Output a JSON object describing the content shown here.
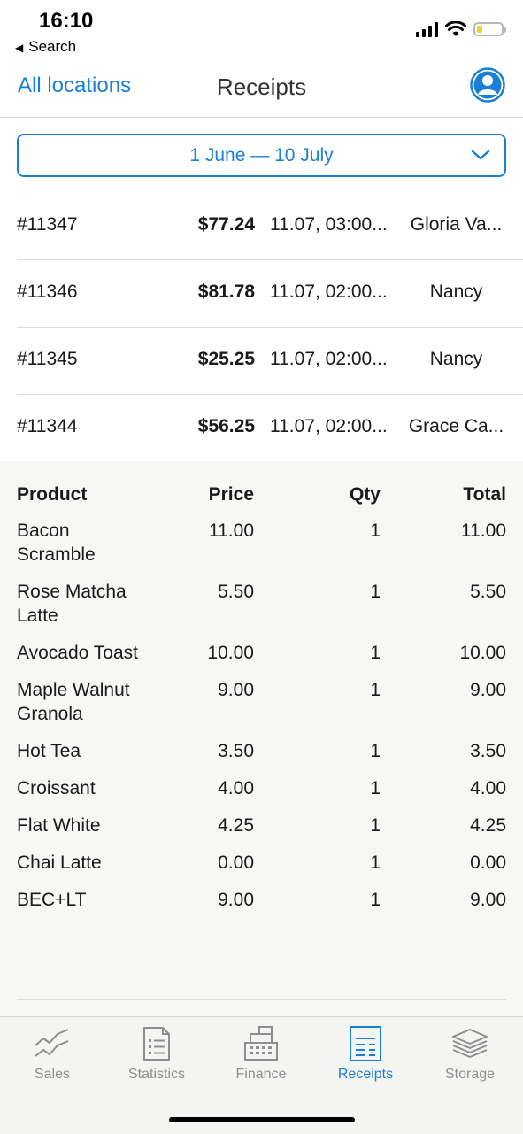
{
  "status_bar": {
    "time": "16:10",
    "back_label": "Search"
  },
  "nav": {
    "left_label": "All locations",
    "title": "Receipts"
  },
  "date_filter": {
    "label": "1 June — 10 July"
  },
  "receipts": [
    {
      "id": "#11347",
      "amount": "$77.24",
      "date": "11.07, 03:00...",
      "employee": "Gloria Va..."
    },
    {
      "id": "#11346",
      "amount": "$81.78",
      "date": "11.07, 02:00...",
      "employee": "Nancy"
    },
    {
      "id": "#11345",
      "amount": "$25.25",
      "date": "11.07, 02:00...",
      "employee": "Nancy"
    },
    {
      "id": "#11344",
      "amount": "$56.25",
      "date": "11.07, 02:00...",
      "employee": "Grace Ca..."
    }
  ],
  "detail": {
    "headers": {
      "product": "Product",
      "price": "Price",
      "qty": "Qty",
      "total": "Total"
    },
    "items": [
      {
        "product": "Bacon Scramble",
        "price": "11.00",
        "qty": "1",
        "total": "11.00"
      },
      {
        "product": "Rose Matcha Latte",
        "price": "5.50",
        "qty": "1",
        "total": "5.50"
      },
      {
        "product": "Avocado Toast",
        "price": "10.00",
        "qty": "1",
        "total": "10.00"
      },
      {
        "product": "Maple Walnut Granola",
        "price": "9.00",
        "qty": "1",
        "total": "9.00"
      },
      {
        "product": "Hot Tea",
        "price": "3.50",
        "qty": "1",
        "total": "3.50"
      },
      {
        "product": "Croissant",
        "price": "4.00",
        "qty": "1",
        "total": "4.00"
      },
      {
        "product": "Flat White",
        "price": "4.25",
        "qty": "1",
        "total": "4.25"
      },
      {
        "product": "Chai Latte",
        "price": "0.00",
        "qty": "1",
        "total": "0.00"
      },
      {
        "product": "BEC+LT",
        "price": "9.00",
        "qty": "1",
        "total": "9.00"
      }
    ]
  },
  "tabs": [
    {
      "label": "Sales",
      "icon": "chart-line-icon",
      "active": false
    },
    {
      "label": "Statistics",
      "icon": "document-list-icon",
      "active": false
    },
    {
      "label": "Finance",
      "icon": "cash-register-icon",
      "active": false
    },
    {
      "label": "Receipts",
      "icon": "receipt-icon",
      "active": true
    },
    {
      "label": "Storage",
      "icon": "stack-layers-icon",
      "active": false
    }
  ],
  "colors": {
    "accent": "#1a7fd6",
    "inactive": "#8e8e8e",
    "battery": "#f2d21a"
  }
}
